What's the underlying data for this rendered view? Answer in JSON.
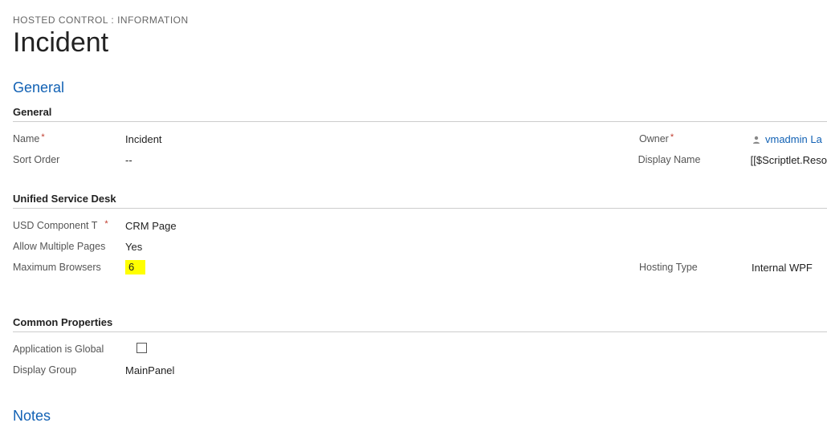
{
  "header": {
    "breadcrumb": "HOSTED CONTROL : INFORMATION",
    "title": "Incident"
  },
  "sections": {
    "general": {
      "title": "General",
      "subsection_label": "General",
      "name": {
        "label": "Name",
        "value": "Incident",
        "required": true
      },
      "sort_order": {
        "label": "Sort Order",
        "value": "--"
      },
      "owner": {
        "label": "Owner",
        "value": "vmadmin La",
        "required": true
      },
      "display_name": {
        "label": "Display Name",
        "value": "[[$Scriptlet.Reso"
      }
    },
    "usd": {
      "subsection_label": "Unified Service Desk",
      "component_type": {
        "label": "USD Component T",
        "value": "CRM Page",
        "required": true
      },
      "allow_multiple": {
        "label": "Allow Multiple Pages",
        "value": "Yes"
      },
      "max_browsers": {
        "label": "Maximum Browsers",
        "value": "6"
      },
      "hosting_type": {
        "label": "Hosting Type",
        "value": "Internal WPF"
      }
    },
    "common": {
      "subsection_label": "Common Properties",
      "app_global": {
        "label": "Application is Global"
      },
      "display_group": {
        "label": "Display Group",
        "value": "MainPanel"
      }
    },
    "notes": {
      "title": "Notes"
    }
  }
}
